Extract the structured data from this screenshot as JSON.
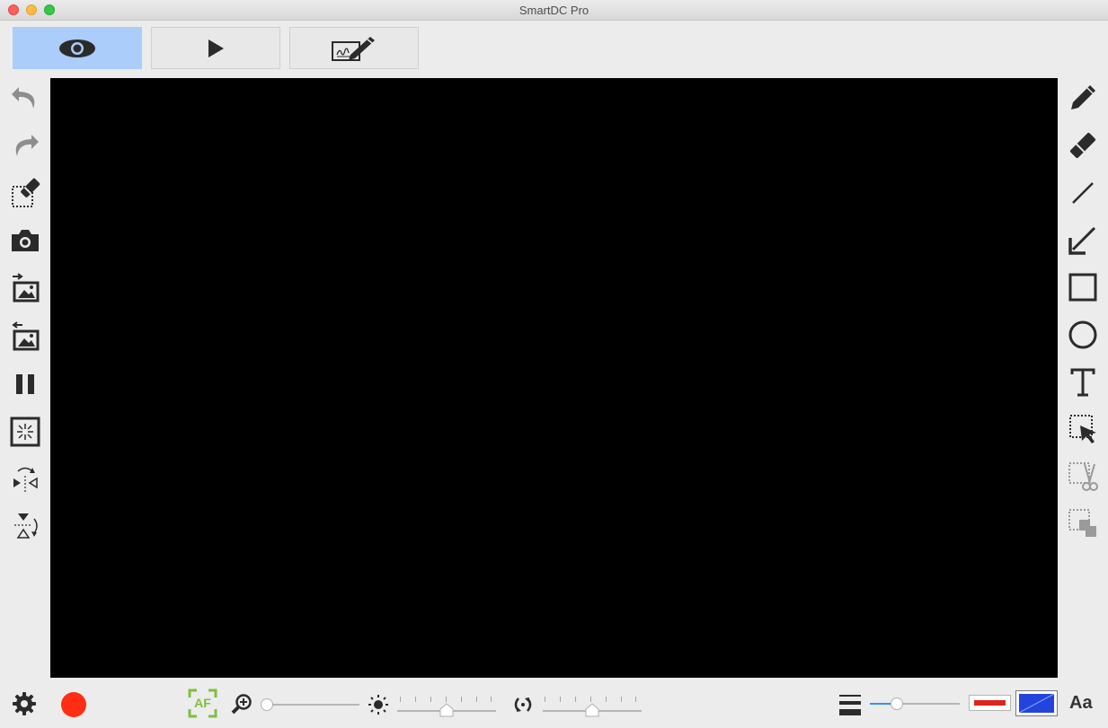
{
  "window": {
    "title": "SmartDC Pro"
  },
  "modes": [
    {
      "name": "view",
      "icon": "eye-icon",
      "active": true
    },
    {
      "name": "play",
      "icon": "play-icon",
      "active": false
    },
    {
      "name": "annotate",
      "icon": "signature-pen-icon",
      "active": false
    }
  ],
  "left_toolbar": [
    "undo-icon",
    "redo-icon",
    "clear-selection-icon",
    "camera-icon",
    "import-image-icon",
    "export-image-icon",
    "pause-icon",
    "timer-capture-icon",
    "flip-horizontal-icon",
    "flip-vertical-icon"
  ],
  "right_toolbar": [
    "pencil-icon",
    "eraser-icon",
    "line-icon",
    "arrow-icon",
    "rectangle-icon",
    "circle-icon",
    "text-icon",
    "select-arrow-icon",
    "cut-icon",
    "copy-icon"
  ],
  "bottom_bar": {
    "af_label": "AF",
    "zoom_level": 0,
    "brightness_level": 0.5,
    "exposure_level": 0.5,
    "line_width_level": 0.3,
    "font_label": "Aa"
  },
  "colors": {
    "accent": "#aacdfa",
    "record": "#ff2d14",
    "af_green": "#7fbf3f",
    "stroke_color": "#e0241c",
    "fill_color": "#2244dd",
    "slider_active": "#3a8ff0"
  }
}
